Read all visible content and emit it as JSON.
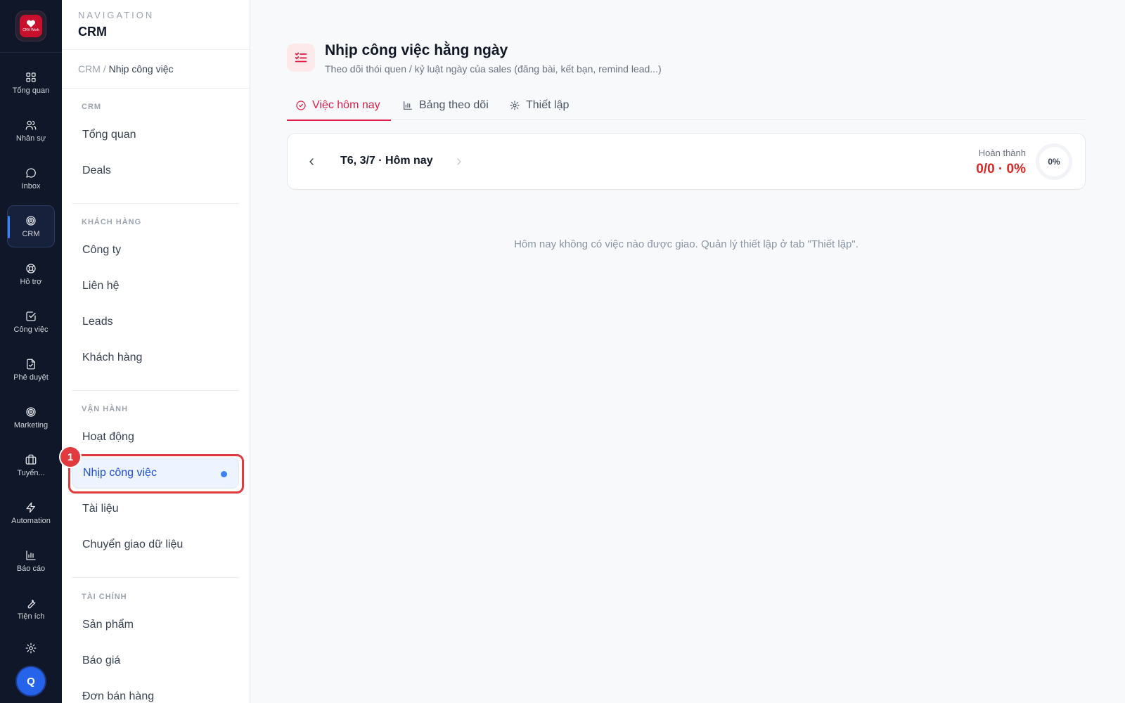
{
  "rail": {
    "logo_text": "CNV Work",
    "items": [
      {
        "label": "Tổng quan",
        "icon": "grid-icon"
      },
      {
        "label": "Nhân sự",
        "icon": "users-icon"
      },
      {
        "label": "Inbox",
        "icon": "chat-icon"
      },
      {
        "label": "CRM",
        "icon": "target-icon"
      },
      {
        "label": "Hỗ trợ",
        "icon": "lifebuoy-icon"
      },
      {
        "label": "Công việc",
        "icon": "checkbox-icon"
      },
      {
        "label": "Phê duyệt",
        "icon": "file-check-icon"
      },
      {
        "label": "Marketing",
        "icon": "target-icon"
      },
      {
        "label": "Tuyển...",
        "icon": "briefcase-icon"
      },
      {
        "label": "Automation",
        "icon": "lightning-icon"
      },
      {
        "label": "Báo cáo",
        "icon": "bar-chart-icon"
      },
      {
        "label": "Tiện ích",
        "icon": "wrench-icon"
      }
    ],
    "avatar": "Q"
  },
  "nav": {
    "eyebrow": "NAVIGATION",
    "title": "CRM",
    "breadcrumb": {
      "root": "CRM /",
      "current": "Nhịp công việc"
    },
    "sections": {
      "crm": {
        "label": "CRM",
        "items": [
          "Tổng quan",
          "Deals"
        ]
      },
      "customers": {
        "label": "KHÁCH HÀNG",
        "items": [
          "Công ty",
          "Liên hệ",
          "Leads",
          "Khách hàng"
        ]
      },
      "operations": {
        "label": "VẬN HÀNH",
        "items": [
          "Hoạt động",
          "Nhịp công việc",
          "Tài liệu",
          "Chuyển giao dữ liệu"
        ]
      },
      "finance": {
        "label": "TÀI CHÍNH",
        "items": [
          "Sản phẩm",
          "Báo giá",
          "Đơn bán hàng"
        ]
      }
    },
    "marker": "1"
  },
  "main": {
    "title": "Nhịp công việc hằng ngày",
    "subtitle": "Theo dõi thói quen / kỷ luật ngày của sales (đăng bài, kết bạn, remind lead...)",
    "tabs": [
      {
        "label": "Việc hôm nay",
        "icon": "check-circle-icon"
      },
      {
        "label": "Bảng theo dõi",
        "icon": "bar-chart-icon"
      },
      {
        "label": "Thiết lập",
        "icon": "gear-icon"
      }
    ],
    "day": {
      "date": "T6, 3/7 · Hôm nay",
      "done_label": "Hoàn thành",
      "done_value": "0/0 · 0%",
      "progress": "0%"
    },
    "empty_message": "Hôm nay không có việc nào được giao. Quản lý thiết lập ở tab \"Thiết lập\"."
  },
  "colors": {
    "accent": "#e11d48",
    "active_nav": "#1d4ed8",
    "rail_bg": "#0f1729",
    "marker": "#e03a3e"
  }
}
